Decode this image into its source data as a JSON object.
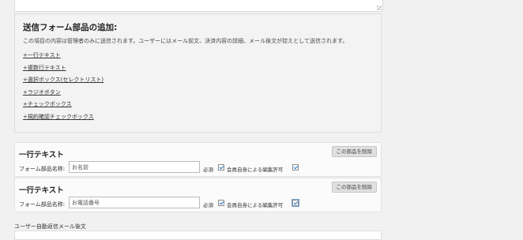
{
  "add_section": {
    "title": "送信フォーム部品の追加:",
    "description": "この項目の内容は管理者のみに送信されます。ユーザーにはメール前文、決済内容の詳細、メール後文が控えとして送信されます。",
    "links": [
      "+一行テキスト",
      "+複数行テキスト",
      "+選択ボックス(セレクトリスト)",
      "+ラジオボタン",
      "+チェックボックス",
      "+規約確認チェックボックス"
    ]
  },
  "fields": [
    {
      "title": "一行テキスト",
      "delete_label": "この部品を削除",
      "name_label": "フォーム部品名称:",
      "name_value": "お名前",
      "required_label": "必須",
      "required_checked": true,
      "edit_label": "会員自身による編集許可",
      "edit_checked": true
    },
    {
      "title": "一行テキスト",
      "delete_label": "この部品を削除",
      "name_label": "フォーム部品名称:",
      "name_value": "お電話番号",
      "required_label": "必須",
      "required_checked": true,
      "edit_label": "会員自身による編集許可",
      "edit_checked": true
    }
  ],
  "auto_reply": {
    "label": "ユーザー自動返信メール後文"
  }
}
